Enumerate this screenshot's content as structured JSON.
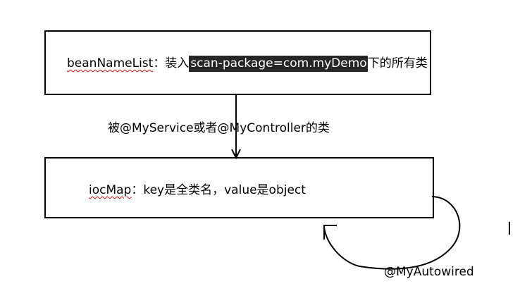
{
  "top_box": {
    "var_name": "beanNameList",
    "sep": "：装入",
    "highlight": "scan-package=com.myDemo",
    "suffix": "下的所有类"
  },
  "edge_label": "被@MyService或者@MyController的类",
  "bottom_box": {
    "var_name": "iocMap",
    "text": "：key是全类名，value是object"
  },
  "loop_label": "@MyAutowired"
}
